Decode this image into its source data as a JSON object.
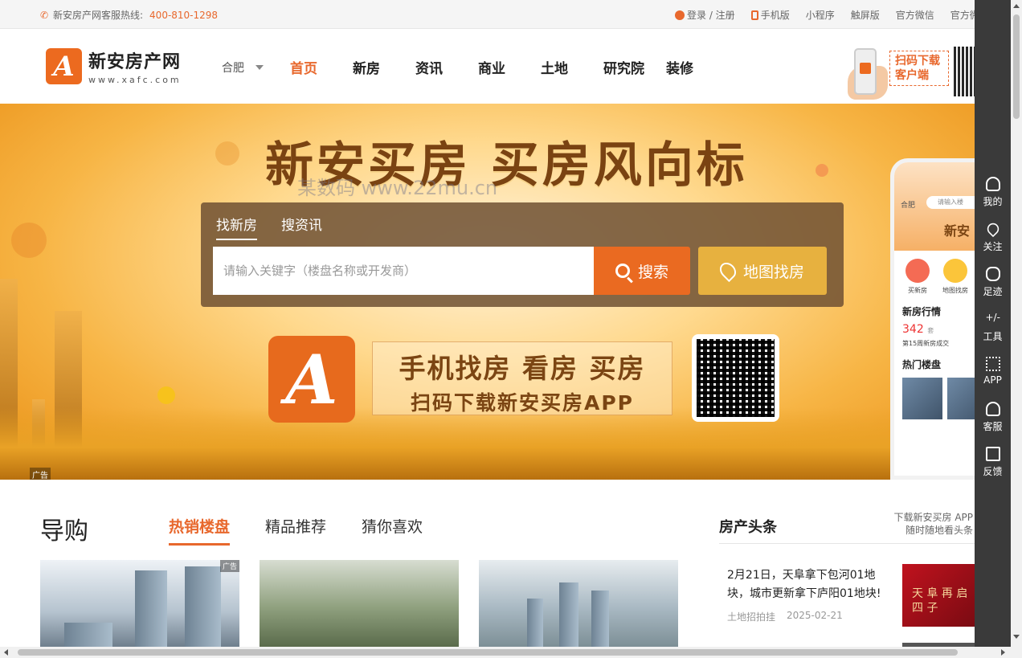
{
  "topbar": {
    "hotline_label": "新安房产网客服热线:",
    "hotline_number": "400-810-1298",
    "links": [
      "登录 / 注册",
      "手机版",
      "小程序",
      "触屏版",
      "官方微信",
      "官方微"
    ]
  },
  "header": {
    "logo_cn": "新安房产网",
    "logo_en": "www.xafc.com",
    "logo_letter": "A",
    "city": "合肥",
    "nav": [
      "首页",
      "新房",
      "资讯",
      "商业",
      "土地",
      "研究院",
      "装修"
    ],
    "download": "扫码下载客户端"
  },
  "banner": {
    "slogan": "新安买房 买房风向标",
    "watermark": "某数码 www.22mu.cn",
    "search_tabs": [
      "找新房",
      "搜资讯"
    ],
    "search_placeholder": "请输入关键字（楼盘名称或开发商）",
    "search_button": "搜索",
    "map_button": "地图找房",
    "app_line1": "手机找房 看房 买房",
    "app_line2": "扫码下载新安买房APP",
    "ad_label": "广告"
  },
  "phone_mock": {
    "city": "合肥",
    "search": "请输入楼",
    "banner": "新安",
    "icon1": "买新房",
    "icon2": "地图找房",
    "section1": "新房行情",
    "count": "342",
    "count_unit": "套",
    "sub": "第15周新房成交",
    "section2": "热门楼盘"
  },
  "sidebar": [
    "我的",
    "关注",
    "足迹",
    "工具",
    "APP",
    "客服",
    "反馈"
  ],
  "guide": {
    "title": "导购",
    "tabs": [
      "热销楼盘",
      "精品推荐",
      "猜你喜欢"
    ],
    "ad_label": "广告"
  },
  "news": {
    "title": "房产头条",
    "download_line1": "下载新安买房 APP",
    "download_line2": "随时随地看头条",
    "headline": "2月21日，天阜拿下包河01地块，城市更新拿下庐阳01地块!",
    "category": "土地招拍挂",
    "date": "2025-02-21",
    "image_text": "天 阜 再 启 四 子"
  },
  "colors": {
    "accent": "#e8682d",
    "sidebar": "#3a3a3a",
    "map_button": "#e7b13f"
  }
}
